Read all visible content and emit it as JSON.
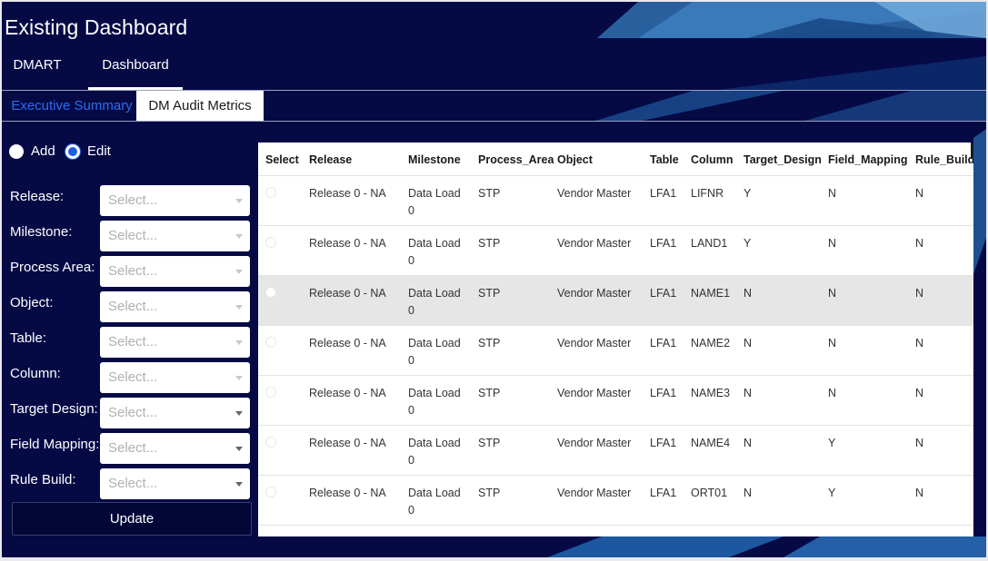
{
  "app": {
    "title": "Existing Dashboard"
  },
  "top_nav": {
    "items": [
      {
        "label": "DMART"
      },
      {
        "label": "Dashboard",
        "active": true
      }
    ]
  },
  "sub_tabs": {
    "items": [
      {
        "label": "Executive Summary"
      },
      {
        "label": "DM Audit Metrics",
        "active": true
      }
    ]
  },
  "mode": {
    "options": [
      {
        "label": "Add",
        "checked": false
      },
      {
        "label": "Edit",
        "checked": true
      }
    ]
  },
  "form": {
    "fields": [
      {
        "label": "Release:",
        "placeholder": "Select..."
      },
      {
        "label": "Milestone:",
        "placeholder": "Select..."
      },
      {
        "label": "Process Area:",
        "placeholder": "Select..."
      },
      {
        "label": "Object:",
        "placeholder": "Select..."
      },
      {
        "label": "Table:",
        "placeholder": "Select..."
      },
      {
        "label": "Column:",
        "placeholder": "Select..."
      },
      {
        "label": "Target Design:",
        "placeholder": "Select..."
      },
      {
        "label": "Field Mapping:",
        "placeholder": "Select..."
      },
      {
        "label": "Rule Build:",
        "placeholder": "Select..."
      }
    ],
    "update_label": "Update"
  },
  "table": {
    "columns": [
      "Select",
      "Release",
      "Milestone",
      "Process_Area",
      "Object",
      "Table",
      "Column",
      "Target_Design",
      "Field_Mapping",
      "Rule_Build"
    ],
    "rows": [
      {
        "release": "Release 0 - NA",
        "milestone": "Data Load 0",
        "process_area": "STP",
        "object": "Vendor Master",
        "table": "LFA1",
        "column": "LIFNR",
        "target_design": "Y",
        "field_mapping": "N",
        "rule_build": "N"
      },
      {
        "release": "Release 0 - NA",
        "milestone": "Data Load 0",
        "process_area": "STP",
        "object": "Vendor Master",
        "table": "LFA1",
        "column": "LAND1",
        "target_design": "Y",
        "field_mapping": "N",
        "rule_build": "N"
      },
      {
        "release": "Release 0 - NA",
        "milestone": "Data Load 0",
        "process_area": "STP",
        "object": "Vendor Master",
        "table": "LFA1",
        "column": "NAME1",
        "target_design": "N",
        "field_mapping": "N",
        "rule_build": "N"
      },
      {
        "release": "Release 0 - NA",
        "milestone": "Data Load 0",
        "process_area": "STP",
        "object": "Vendor Master",
        "table": "LFA1",
        "column": "NAME2",
        "target_design": "N",
        "field_mapping": "N",
        "rule_build": "N"
      },
      {
        "release": "Release 0 - NA",
        "milestone": "Data Load 0",
        "process_area": "STP",
        "object": "Vendor Master",
        "table": "LFA1",
        "column": "NAME3",
        "target_design": "N",
        "field_mapping": "N",
        "rule_build": "N"
      },
      {
        "release": "Release 0 - NA",
        "milestone": "Data Load 0",
        "process_area": "STP",
        "object": "Vendor Master",
        "table": "LFA1",
        "column": "NAME4",
        "target_design": "N",
        "field_mapping": "Y",
        "rule_build": "N"
      },
      {
        "release": "Release 0 - NA",
        "milestone": "Data Load 0",
        "process_area": "STP",
        "object": "Vendor Master",
        "table": "LFA1",
        "column": "ORT01",
        "target_design": "N",
        "field_mapping": "Y",
        "rule_build": "N"
      }
    ]
  },
  "colors": {
    "background": "#050a45",
    "accent": "#2f6cf0",
    "panel": "#ffffff"
  }
}
